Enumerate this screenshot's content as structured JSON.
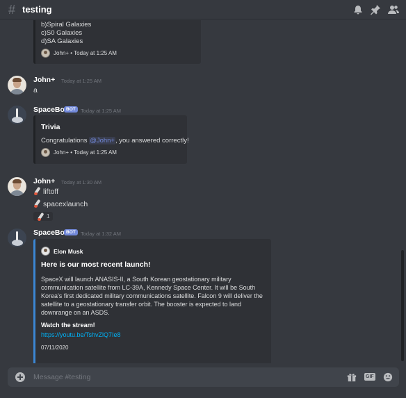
{
  "channel": {
    "name": "testing"
  },
  "top_embed": {
    "options": [
      "b)Spiral Galaxies",
      "c)S0 Galaxies",
      "d)SA Galaxies"
    ],
    "footer": "John+ • Today at 1:25 AM"
  },
  "messages": [
    {
      "author": "John+",
      "time": "Today at 1:25 AM",
      "text": "a"
    },
    {
      "author": "SpaceBot",
      "badge": "BOT",
      "time": "Today at 1:25 AM",
      "embed": {
        "title": "Trivia",
        "prefix": "Congratulations ",
        "mention": "@John+",
        "suffix": ", you answered correctly!",
        "footer": "John+ • Today at 1:25 AM"
      }
    },
    {
      "author": "John+",
      "time": "Today at 1:30 AM",
      "lines": [
        "liftoff",
        "spacexlaunch"
      ],
      "reaction": {
        "count": "1"
      }
    },
    {
      "author": "SpaceBot",
      "badge": "BOT",
      "time": "Today at 1:32 AM",
      "embed": {
        "author": "Elon Musk",
        "title": "Here is our most recent launch!",
        "description": [
          "SpaceX will launch ANASIS-II, a South Korean geostationary military",
          "communication satellite from LC-39A, Kennedy Space Center. It will be South",
          "Korea's first dedicated military communications satellite. Falcon 9 will deliver the",
          "satellite to a geostationary transfer orbit. The booster is expected to land",
          "downrange on an ASDS."
        ],
        "field_title": "Watch the stream!",
        "link": "https://youtu.be/TshvZlQ7Ie8",
        "date": "07/11/2020"
      }
    }
  ],
  "input": {
    "placeholder": "Message #testing",
    "gif_label": "GIF"
  },
  "icons": {
    "header": [
      "bell-icon",
      "pin-icon",
      "members-icon"
    ],
    "input": [
      "add-attachment-icon",
      "gift-icon",
      "gif-icon",
      "emoji-icon"
    ],
    "reaction": "rocket-emoji"
  },
  "colors": {
    "background": "#36393f",
    "embed": "#2f3136",
    "accent": "#3b86d4",
    "bot_badge": "#7289da",
    "link": "#00b0f4"
  }
}
